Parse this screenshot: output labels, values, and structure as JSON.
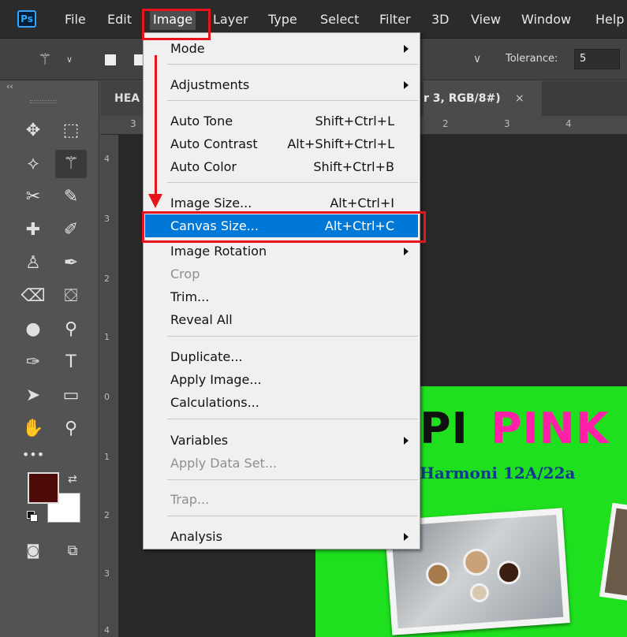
{
  "menubar": {
    "logo": "Ps",
    "items": [
      "File",
      "Edit",
      "Image",
      "Layer",
      "Type",
      "Select",
      "Filter",
      "3D",
      "View",
      "Window",
      "Help"
    ],
    "active": "Image"
  },
  "options": {
    "tolerance_label": "Tolerance:",
    "tolerance_value": "5"
  },
  "toolbar": {
    "collapse": "‹‹",
    "tools": [
      {
        "name": "move-tool-icon",
        "glyph": "✥"
      },
      {
        "name": "marquee-tool-icon",
        "glyph": "⬚"
      },
      {
        "name": "lasso-tool-icon",
        "glyph": "⟡"
      },
      {
        "name": "magic-wand-tool-icon",
        "glyph": "⚚"
      },
      {
        "name": "crop-tool-icon",
        "glyph": "✂"
      },
      {
        "name": "eyedropper-tool-icon",
        "glyph": "✎"
      },
      {
        "name": "healing-brush-tool-icon",
        "glyph": "✚"
      },
      {
        "name": "brush-tool-icon",
        "glyph": "✐"
      },
      {
        "name": "clone-stamp-tool-icon",
        "glyph": "♙"
      },
      {
        "name": "history-brush-tool-icon",
        "glyph": "✒"
      },
      {
        "name": "eraser-tool-icon",
        "glyph": "⌫"
      },
      {
        "name": "paint-bucket-tool-icon",
        "glyph": "⛋"
      },
      {
        "name": "blur-tool-icon",
        "glyph": "●"
      },
      {
        "name": "dodge-tool-icon",
        "glyph": "⚲"
      },
      {
        "name": "pen-tool-icon",
        "glyph": "✑"
      },
      {
        "name": "type-tool-icon",
        "glyph": "T"
      },
      {
        "name": "path-selection-tool-icon",
        "glyph": "➤"
      },
      {
        "name": "rectangle-tool-icon",
        "glyph": "▭"
      },
      {
        "name": "hand-tool-icon",
        "glyph": "✋"
      },
      {
        "name": "zoom-tool-icon",
        "glyph": "⚲"
      },
      {
        "name": "more-tools-icon",
        "glyph": "•••"
      }
    ],
    "foreground_color": "#4d0a06",
    "background_color": "#ffffff"
  },
  "document": {
    "tab_left": "HEA",
    "tab_right": "r 3, RGB/8#)",
    "tab_close": "×",
    "ruler_top_ticks": [
      "3",
      "2",
      "3",
      "4"
    ],
    "ruler_left_ticks": [
      "4",
      "3",
      "2",
      "1",
      "0",
      "1",
      "2",
      "3",
      "4"
    ],
    "title_black": "PI",
    "title_pink": "PINK",
    "subtitle": "Harmoni 12A/22a",
    "bg_color": "#1ee01e"
  },
  "menu": {
    "items": [
      {
        "label": "Mode",
        "shortcut": "",
        "submenu": true,
        "disabled": false
      },
      {
        "label": "Adjustments",
        "shortcut": "",
        "submenu": true,
        "disabled": false
      },
      {
        "label": "Auto Tone",
        "shortcut": "Shift+Ctrl+L",
        "submenu": false,
        "disabled": false
      },
      {
        "label": "Auto Contrast",
        "shortcut": "Alt+Shift+Ctrl+L",
        "submenu": false,
        "disabled": false
      },
      {
        "label": "Auto Color",
        "shortcut": "Shift+Ctrl+B",
        "submenu": false,
        "disabled": false
      },
      {
        "label": "Image Size...",
        "shortcut": "Alt+Ctrl+I",
        "submenu": false,
        "disabled": false
      },
      {
        "label": "Canvas Size...",
        "shortcut": "Alt+Ctrl+C",
        "submenu": false,
        "disabled": false,
        "highlighted": true
      },
      {
        "label": "Image Rotation",
        "shortcut": "",
        "submenu": true,
        "disabled": false
      },
      {
        "label": "Crop",
        "shortcut": "",
        "submenu": false,
        "disabled": true
      },
      {
        "label": "Trim...",
        "shortcut": "",
        "submenu": false,
        "disabled": false
      },
      {
        "label": "Reveal All",
        "shortcut": "",
        "submenu": false,
        "disabled": false
      },
      {
        "label": "Duplicate...",
        "shortcut": "",
        "submenu": false,
        "disabled": false
      },
      {
        "label": "Apply Image...",
        "shortcut": "",
        "submenu": false,
        "disabled": false
      },
      {
        "label": "Calculations...",
        "shortcut": "",
        "submenu": false,
        "disabled": false
      },
      {
        "label": "Variables",
        "shortcut": "",
        "submenu": true,
        "disabled": false
      },
      {
        "label": "Apply Data Set...",
        "shortcut": "",
        "submenu": false,
        "disabled": true
      },
      {
        "label": "Trap...",
        "shortcut": "",
        "submenu": false,
        "disabled": true
      },
      {
        "label": "Analysis",
        "shortcut": "",
        "submenu": true,
        "disabled": false
      }
    ]
  },
  "colors": {
    "annotation_red": "#e8141b",
    "highlight_blue": "#0078d7",
    "menubar_bg": "#2b2b2b"
  }
}
